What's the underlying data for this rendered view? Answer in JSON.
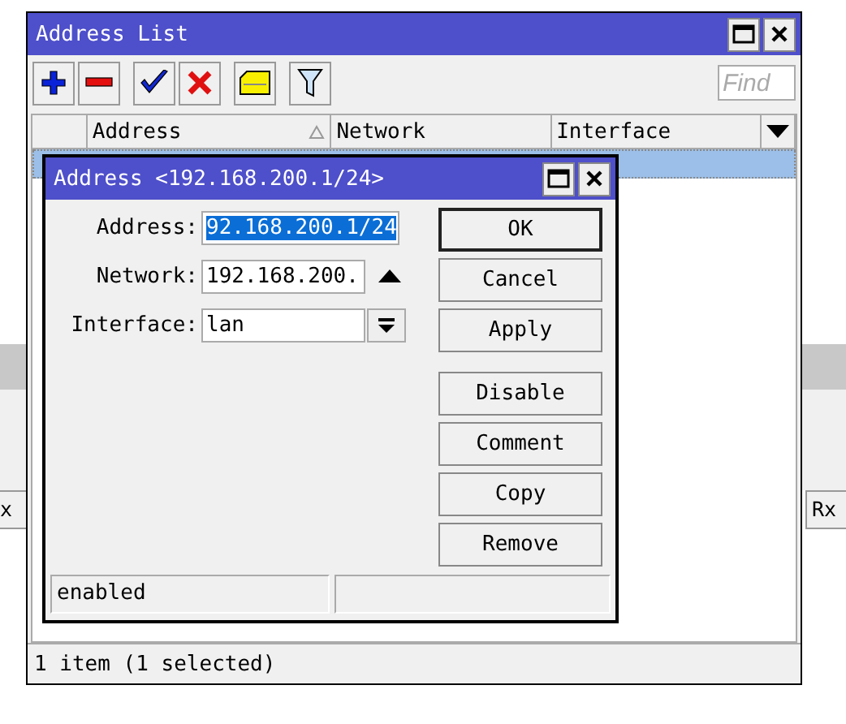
{
  "background": {
    "left_header": "x",
    "right_header": "Rx"
  },
  "window": {
    "title": "Address List",
    "find_placeholder": "Find"
  },
  "toolbar": [
    {
      "kind": "add"
    },
    {
      "kind": "remove"
    },
    {
      "kind": "enable"
    },
    {
      "kind": "disable"
    },
    {
      "kind": "comment"
    },
    {
      "kind": "filter"
    }
  ],
  "table": {
    "columns": [
      {
        "label": "Address",
        "sorted": true
      },
      {
        "label": "Network",
        "sorted": false
      },
      {
        "label": "Interface",
        "sorted": false
      }
    ],
    "rows": [
      {
        "selected": true
      }
    ]
  },
  "status_bar": "1 item (1 selected)",
  "dialog": {
    "title": "Address <192.168.200.1/24>",
    "fields": [
      {
        "label": "Address:",
        "value": "92.168.200.1/24",
        "kind": "text",
        "highlighted": true
      },
      {
        "label": "Network:",
        "value": "192.168.200.",
        "kind": "updown",
        "highlighted": false
      },
      {
        "label": "Interface:",
        "value": "lan",
        "kind": "dropdown",
        "highlighted": false
      }
    ],
    "buttons": [
      {
        "label": "OK",
        "default": true
      },
      {
        "label": "Cancel",
        "default": false
      },
      {
        "label": "Apply",
        "default": false
      }
    ],
    "action_buttons": [
      {
        "label": "Disable"
      },
      {
        "label": "Comment"
      },
      {
        "label": "Copy"
      },
      {
        "label": "Remove"
      }
    ],
    "status": "enabled"
  }
}
